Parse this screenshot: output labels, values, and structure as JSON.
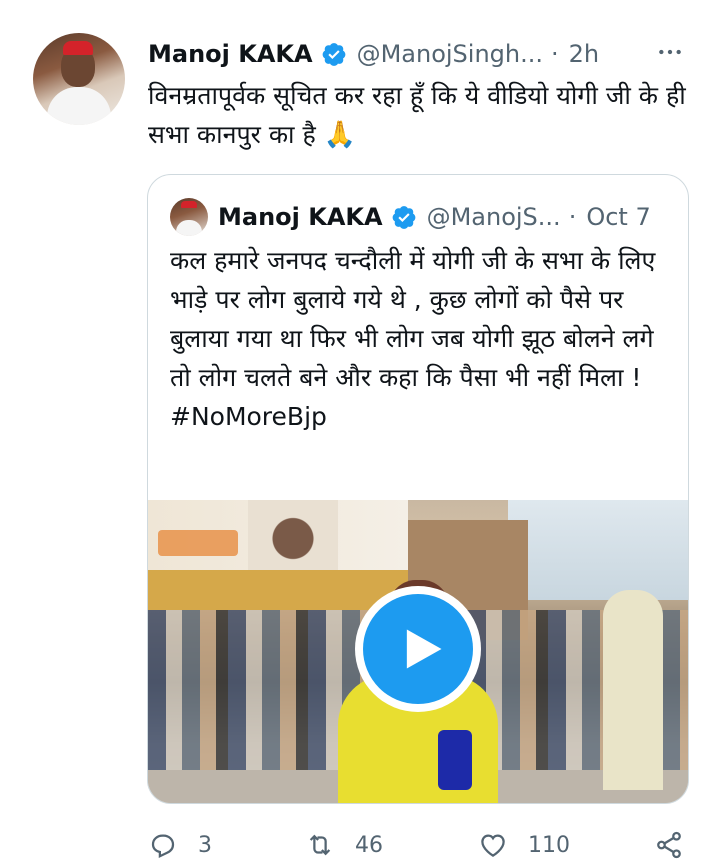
{
  "tweet": {
    "author_name": "Manoj KAKA",
    "author_handle": "@ManojSingh...",
    "separator": "·",
    "time": "2h",
    "text": "विनम्रतापूर्वक सूचित कर रहा हूँ कि ये वीडियो योगी जी के ही सभा कानपुर का है",
    "text_emoji": "🙏"
  },
  "quoted_tweet": {
    "author_name": "Manoj KAKA",
    "author_handle": "@ManojS...",
    "separator": "·",
    "time": "Oct 7",
    "text": "कल हमारे जनपद चन्दौली में योगी जी के सभा के लिए भाड़े पर लोग बुलाये गये थे , कुछ लोगों को पैसे पर बुलाया गया था फिर भी लोग जब योगी झूठ बोलने लगे तो लोग चलते बने और कहा कि पैसा भी नहीं मिला !",
    "hashtag": "#NoMoreBjp"
  },
  "actions": {
    "replies": "3",
    "retweets": "46",
    "likes": "110"
  },
  "colors": {
    "accent": "#1d9bf0",
    "secondary_text": "#536471",
    "border": "#cfd9de"
  },
  "icons": [
    "verified-badge-icon",
    "more-icon",
    "play-icon",
    "reply-icon",
    "retweet-icon",
    "like-icon",
    "share-icon"
  ]
}
